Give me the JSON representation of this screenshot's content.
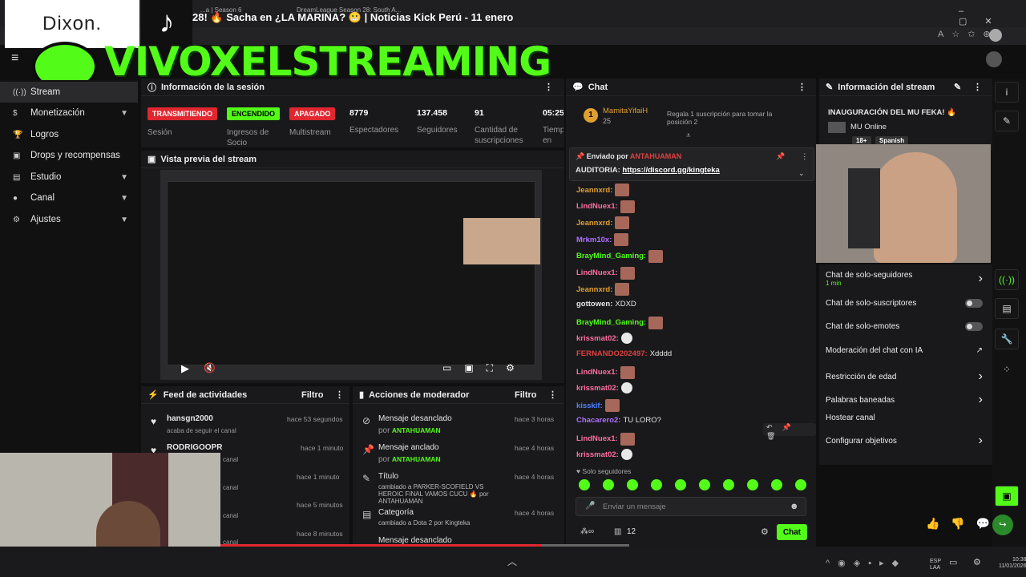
{
  "browser": {
    "tab1": "...a | Season 6",
    "tab2": "DreamLeague Season 28: South A...",
    "video_title": "28! 🔥 Sacha en ¿LA MARINA? 😬 | Noticias Kick Perú - 11 enero"
  },
  "overlay": {
    "sponsor": "Dixon.",
    "banner": "VIVOXELSTREAMING"
  },
  "sidebar": {
    "items": [
      {
        "label": "Stream",
        "icon": "broadcast-icon"
      },
      {
        "label": "Monetización",
        "icon": "dollar-icon"
      },
      {
        "label": "Logros",
        "icon": "trophy-icon"
      },
      {
        "label": "Drops y recompensas",
        "icon": "gift-icon"
      },
      {
        "label": "Estudio",
        "icon": "folder-icon"
      },
      {
        "label": "Canal",
        "icon": "user-icon"
      },
      {
        "label": "Ajustes",
        "icon": "gear-icon"
      }
    ]
  },
  "session": {
    "title": "Información de la sesión",
    "badges": [
      {
        "text": "TRANSMITIENDO",
        "label": "Sesión"
      },
      {
        "text": "ENCENDIDO",
        "label": "Ingresos de Socio"
      },
      {
        "text": "APAGADO",
        "label": "Multistream"
      }
    ],
    "stats": [
      {
        "value": "8779",
        "label": "Espectadores"
      },
      {
        "value": "137.458",
        "label": "Seguidores"
      },
      {
        "value": "91",
        "label": "Cantidad de suscripciones"
      },
      {
        "value": "05:25",
        "label": "Tiempo en vivo"
      }
    ]
  },
  "preview": {
    "title": "Vista previa del stream"
  },
  "feed": {
    "title": "Feed de actividades",
    "filter": "Filtro",
    "items": [
      {
        "name": "hansgn2000",
        "sub": "acaba de seguir el canal",
        "time": "hace 53 segundos"
      },
      {
        "name": "RODRIGOOPR",
        "sub": "canal",
        "time": "hace 1 minuto"
      },
      {
        "name": "",
        "sub": "canal",
        "time": "hace 1 minuto"
      },
      {
        "name": "",
        "sub": "canal",
        "time": "hace 5 minutos"
      },
      {
        "name": "",
        "sub": "canal",
        "time": "hace 8 minutos"
      }
    ]
  },
  "modactions": {
    "title": "Acciones de moderador",
    "filter": "Filtro",
    "items": [
      {
        "title": "Mensaje desanclado",
        "by": "por",
        "user": "ANTAHUAMAN",
        "time": "hace 3 horas"
      },
      {
        "title": "Mensaje anclado",
        "by": "por",
        "user": "ANTAHUAMAN",
        "time": "hace 4 horas"
      },
      {
        "title": "Título",
        "line": "cambiado a PARKER-SCOFIELD VS HEROIC FINAL VAMOS CUCU 🔥 por ANTAHUAMAN",
        "time": "hace 4 horas"
      },
      {
        "title": "Categoría",
        "line": "cambiado a Dota 2 por Kingteka",
        "time": "hace 4 horas"
      },
      {
        "title": "Mensaje desanclado",
        "time": ""
      }
    ]
  },
  "chat": {
    "title": "Chat",
    "gifter": "MamitaYifaiH",
    "gifter_count": "25",
    "gift_text": "Regala 1 suscripción para tomar la posición 2",
    "pinned_by": "Enviado por",
    "pinned_user": "ANTAHUAMAN",
    "pinned_label": "AUDITORIA:",
    "pinned_link": "https://discord.gg/kingteka",
    "messages": [
      {
        "user": "Jeannxrd:",
        "color": "#e0a030"
      },
      {
        "user": "LindNuex1:",
        "color": "#ff6fa0"
      },
      {
        "user": "Jeannxrd:",
        "color": "#e0a030"
      },
      {
        "user": "Mrkm10x:",
        "color": "#b070ff"
      },
      {
        "user": "BrayMind_Gaming:",
        "color": "#53fc18"
      },
      {
        "user": "LindNuex1:",
        "color": "#ff6fa0"
      },
      {
        "user": "Jeannxrd:",
        "color": "#e0a030"
      },
      {
        "user": "gottowen:",
        "color": "#e6e6e6",
        "text": "XDXD"
      },
      {
        "user": "BrayMind_Gaming:",
        "color": "#53fc18"
      },
      {
        "user": "krissmat02:",
        "color": "#ff6fa0"
      },
      {
        "user": "FERNANDO202497:",
        "color": "#e04040",
        "text": "Xdddd"
      },
      {
        "user": "LindNuex1:",
        "color": "#ff6fa0"
      },
      {
        "user": "krissmat02:",
        "color": "#ff6fa0"
      },
      {
        "user": "kisskif:",
        "color": "#5080ff"
      },
      {
        "user": "Chacarero2:",
        "color": "#b070ff",
        "text": "TU LORO?"
      },
      {
        "user": "LindNuex1:",
        "color": "#ff6fa0"
      },
      {
        "user": "krissmat02:",
        "color": "#ff6fa0"
      }
    ],
    "mode": "Solo seguidores",
    "placeholder": "Enviar un mensaje",
    "count": "12",
    "send": "Chat"
  },
  "streaminfo": {
    "title": "Información del stream",
    "stream_title": "INAUGURACIÓN DEL MU FEKA! 🔥",
    "category": "MU Online",
    "tags": [
      "18+",
      "Spanish"
    ]
  },
  "settings": {
    "items": [
      {
        "label": "Chat de solo-seguidores",
        "sub": "1 min",
        "ctrl": "chevron"
      },
      {
        "label": "Chat de solo-suscriptores",
        "ctrl": "toggle"
      },
      {
        "label": "Chat de solo-emotes",
        "ctrl": "toggle"
      },
      {
        "label": "Moderación del chat con IA",
        "ctrl": "external"
      },
      {
        "label": "Restricción de edad",
        "ctrl": "chevron"
      },
      {
        "label": "Palabras baneadas",
        "ctrl": "chevron"
      },
      {
        "label": "Hostear canal",
        "ctrl": "none"
      },
      {
        "label": "Configurar objetivos",
        "ctrl": "chevron"
      }
    ]
  },
  "taskbar": {
    "lang": "ESP LAA",
    "time": "10:38",
    "date": "11/01/2026"
  },
  "colors": {
    "accent": "#53fc18",
    "live": "#e0262f",
    "bg": "#0f0f10",
    "panel": "#19191b"
  }
}
